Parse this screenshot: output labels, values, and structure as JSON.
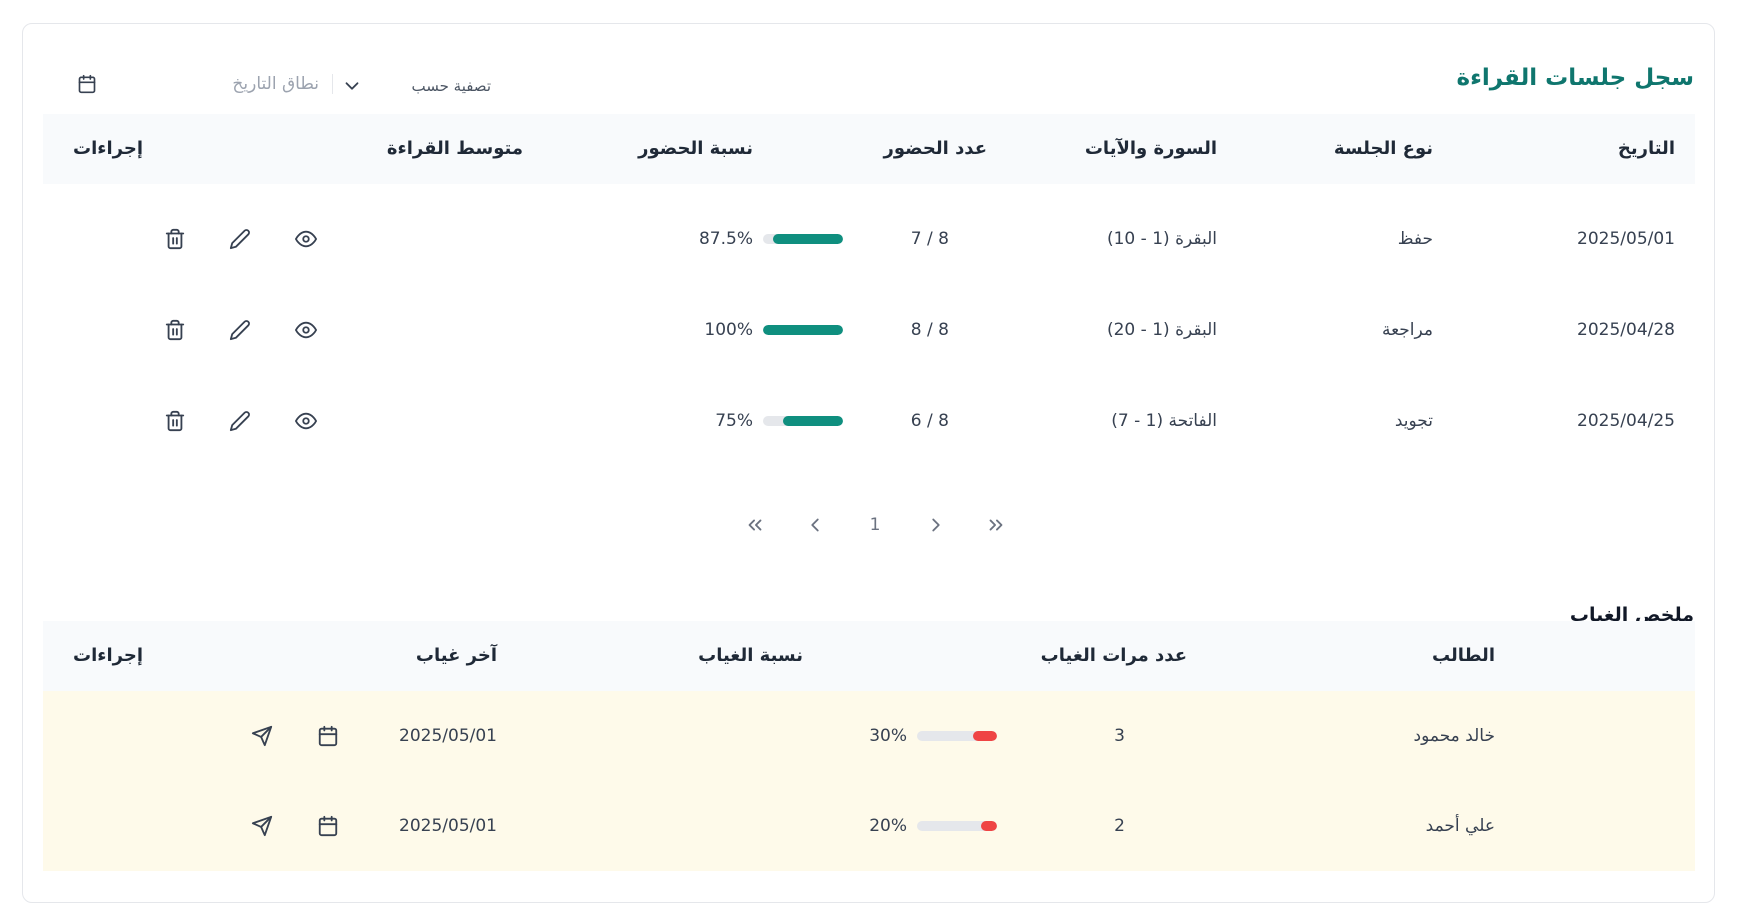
{
  "sessions": {
    "title": "سجل جلسات القراءة",
    "filter_label": "تصفية حسب",
    "date_range_placeholder": "نطاق التاريخ",
    "columns": {
      "date": "التاريخ",
      "type": "نوع الجلسة",
      "surah": "السورة والآيات",
      "attendance_count": "عدد الحضور",
      "attendance_rate": "نسبة الحضور",
      "reading_avg": "متوسط القراءة",
      "actions": "إجراءات"
    },
    "rows": [
      {
        "date": "2025/05/01",
        "type": "حفظ",
        "surah": "البقرة (1 - 10)",
        "count": "8 / 7",
        "rate_label": "87.5%",
        "rate": 87.5
      },
      {
        "date": "2025/04/28",
        "type": "مراجعة",
        "surah": "البقرة (1 - 20)",
        "count": "8 / 8",
        "rate_label": "100%",
        "rate": 100
      },
      {
        "date": "2025/04/25",
        "type": "تجويد",
        "surah": "الفاتحة (1 - 7)",
        "count": "8 / 6",
        "rate_label": "75%",
        "rate": 75
      }
    ],
    "pagination": {
      "current_page": "1"
    }
  },
  "absence": {
    "title": "ملخص الغياب",
    "columns": {
      "student": "الطالب",
      "absence_count": "عدد مرات الغياب",
      "absence_rate": "نسبة الغياب",
      "last_absence": "آخر غياب",
      "actions": "إجراءات"
    },
    "rows": [
      {
        "student": "خالد محمود",
        "count": "3",
        "rate_label": "30%",
        "rate": 30,
        "last": "2025/05/01"
      },
      {
        "student": "علي أحمد",
        "count": "2",
        "rate_label": "20%",
        "rate": 20,
        "last": "2025/05/01"
      }
    ]
  },
  "colors": {
    "accent": "#0f8f7f",
    "title": "#0f766e",
    "absence_bar": "#ef4444",
    "highlight_row": "#fefaea"
  },
  "icons": {
    "calendar": "calendar-icon",
    "chevron": "chevron-down-icon",
    "view": "eye-icon",
    "edit": "pencil-icon",
    "delete": "trash-icon",
    "send": "send-icon",
    "first": "chevrons-right-icon",
    "prev": "chevron-right-icon",
    "next": "chevron-left-icon",
    "last": "chevrons-left-icon"
  }
}
